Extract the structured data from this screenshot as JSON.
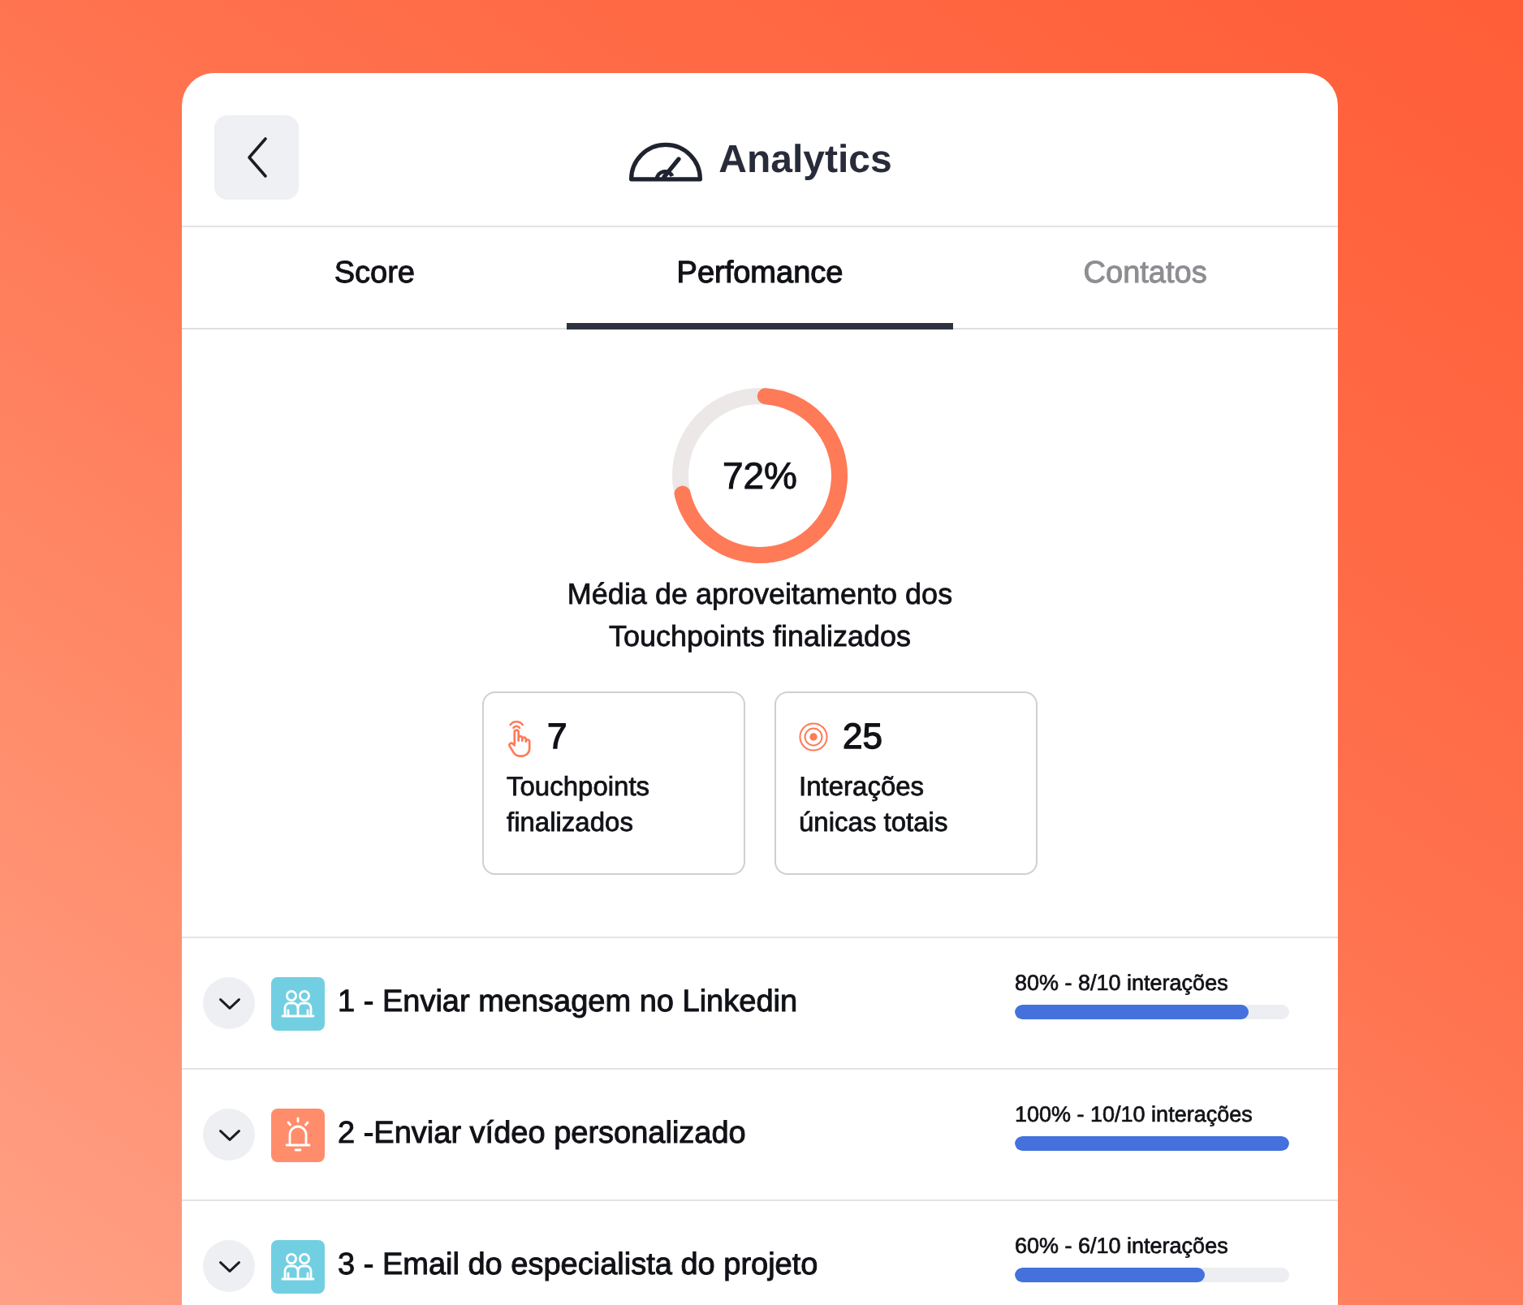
{
  "header": {
    "title": "Analytics"
  },
  "tabs": [
    {
      "label": "Score",
      "selected": false,
      "disabled": false
    },
    {
      "label": "Perfomance",
      "selected": true,
      "disabled": false
    },
    {
      "label": "Contatos",
      "selected": false,
      "disabled": true
    }
  ],
  "summary": {
    "level": 0.72,
    "reading": "72%",
    "caption": "Média de aproveitamento dos Touchpoints finalizados"
  },
  "stats": [
    {
      "kind": "touch",
      "value": "7",
      "label": "Touchpoints finalizados"
    },
    {
      "kind": "target",
      "value": "25",
      "label": "Interações únicas totais"
    }
  ],
  "touchpoints": [
    {
      "kind": "group",
      "color": "#72cfe2",
      "title": "1 - Enviar mensagem no Linkedin",
      "expanded": false,
      "reading": "80% - 8/10 interações",
      "level": 0.85
    },
    {
      "kind": "bell",
      "color": "#ff8d6c",
      "title": "2 -Enviar vídeo personalizado",
      "expanded": false,
      "reading": "100% - 10/10 interações",
      "level": 1
    },
    {
      "kind": "group",
      "color": "#72cfe2",
      "title": "3 - Email do especialista do projeto",
      "expanded": false,
      "reading": "60% - 6/10 interações",
      "level": 0.69
    }
  ]
}
